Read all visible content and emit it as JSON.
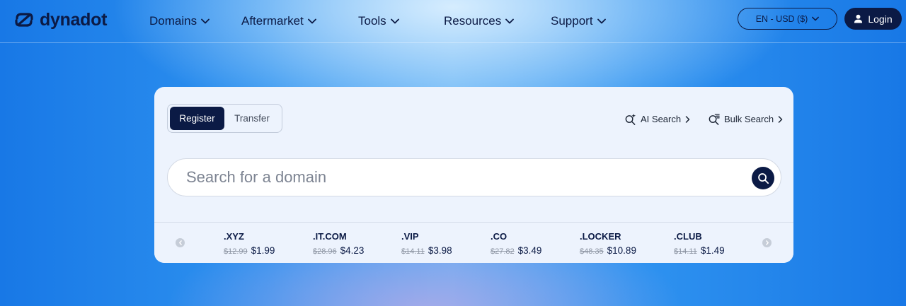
{
  "brand": {
    "name": "dynadot"
  },
  "nav": {
    "items": [
      {
        "label": "Domains"
      },
      {
        "label": "Aftermarket"
      },
      {
        "label": "Tools"
      },
      {
        "label": "Resources"
      },
      {
        "label": "Support"
      }
    ]
  },
  "header": {
    "language_currency": "EN - USD ($)",
    "login_label": "Login"
  },
  "search_card": {
    "tabs": [
      {
        "label": "Register",
        "active": true
      },
      {
        "label": "Transfer",
        "active": false
      }
    ],
    "ai_search_label": "AI Search",
    "bulk_search_label": "Bulk Search",
    "search_placeholder": "Search for a domain",
    "search_value": ""
  },
  "tlds": [
    {
      "name": ".XYZ",
      "old_price": "$12.99",
      "price": "$1.99"
    },
    {
      "name": ".IT.COM",
      "old_price": "$28.96",
      "price": "$4.23"
    },
    {
      "name": ".VIP",
      "old_price": "$14.11",
      "price": "$3.98"
    },
    {
      "name": ".CO",
      "old_price": "$27.82",
      "price": "$3.49"
    },
    {
      "name": ".LOCKER",
      "old_price": "$48.35",
      "price": "$10.89"
    },
    {
      "name": ".CLUB",
      "old_price": "$14.11",
      "price": "$1.49"
    }
  ],
  "icons": {
    "logo": "dynadot-logo-icon",
    "nav_chevron": "chevron-down-icon",
    "login": "user-icon",
    "ai_search": "ai-search-icon",
    "bulk_search": "bulk-search-icon",
    "link_chevron": "chevron-right-icon",
    "search": "search-icon",
    "carousel_prev": "chevron-left-icon",
    "carousel_next": "chevron-right-icon"
  },
  "colors": {
    "brand_navy": "#0b1a45",
    "card_background": "#edf3fd",
    "page_blue": "#2f93f0"
  }
}
